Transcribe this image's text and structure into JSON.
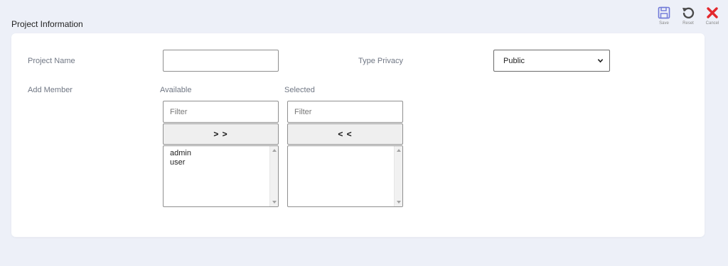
{
  "page": {
    "title": "Project Information"
  },
  "toolbar": {
    "save_label": "Save",
    "reset_label": "Reset",
    "cancel_label": "Cancel",
    "colors": {
      "save": "#6f78d8",
      "reset": "#4a4a4a",
      "cancel": "#e3282d"
    }
  },
  "form": {
    "project_name_label": "Project Name",
    "project_name_value": "",
    "type_privacy_label": "Type Privacy",
    "type_privacy_value": "Public",
    "add_member_label": "Add Member",
    "available": {
      "title": "Available",
      "filter_placeholder": "Filter",
      "move_label": "> >",
      "items": [
        "admin",
        "user"
      ]
    },
    "selected": {
      "title": "Selected",
      "filter_placeholder": "Filter",
      "move_label": "< <",
      "items": []
    }
  }
}
